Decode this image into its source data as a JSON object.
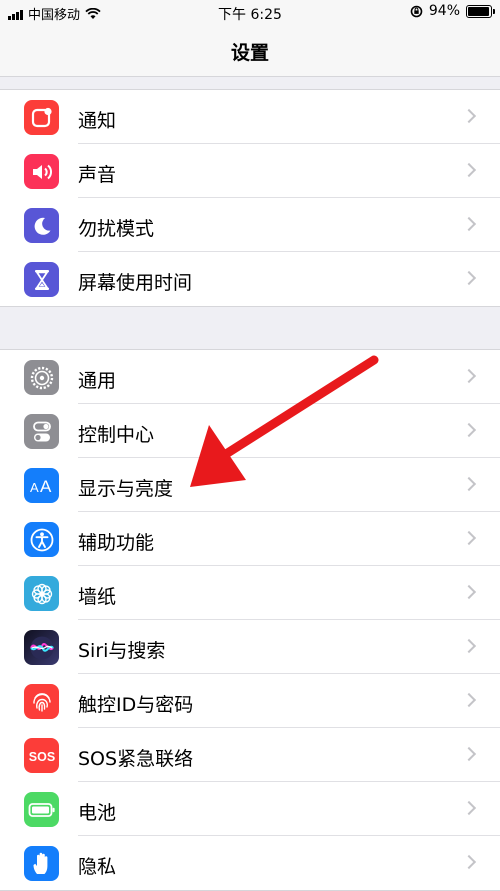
{
  "status_bar": {
    "carrier": "中国移动",
    "time": "下午 6:25",
    "battery": "94%",
    "battery_level": 0.94
  },
  "nav": {
    "title": "设置"
  },
  "groups": [
    {
      "items": [
        {
          "label": "通知",
          "icon": "notifications-icon",
          "color": "#fc3d39"
        },
        {
          "label": "声音",
          "icon": "sounds-icon",
          "color": "#fc3158"
        },
        {
          "label": "勿扰模式",
          "icon": "moon-icon",
          "color": "#5856d6"
        },
        {
          "label": "屏幕使用时间",
          "icon": "hourglass-icon",
          "color": "#5856d6"
        }
      ]
    },
    {
      "items": [
        {
          "label": "通用",
          "icon": "gear-icon",
          "color": "#8e8e93"
        },
        {
          "label": "控制中心",
          "icon": "toggles-icon",
          "color": "#8e8e93"
        },
        {
          "label": "显示与亮度",
          "icon": "aa-icon",
          "color": "#147efb"
        },
        {
          "label": "辅助功能",
          "icon": "accessibility-icon",
          "color": "#147efb"
        },
        {
          "label": "墙纸",
          "icon": "flower-icon",
          "color": "#34aadc"
        },
        {
          "label": "Siri与搜索",
          "icon": "siri-icon",
          "color": "#1c1c3a"
        },
        {
          "label": "触控ID与密码",
          "icon": "fingerprint-icon",
          "color": "#fc3d39"
        },
        {
          "label": "SOS紧急联络",
          "icon": "sos-icon",
          "color": "#fc3d39"
        },
        {
          "label": "电池",
          "icon": "battery-icon",
          "color": "#4cd964"
        },
        {
          "label": "隐私",
          "icon": "hand-icon",
          "color": "#147efb"
        }
      ]
    }
  ],
  "annotation": {
    "color": "#e8191c"
  }
}
